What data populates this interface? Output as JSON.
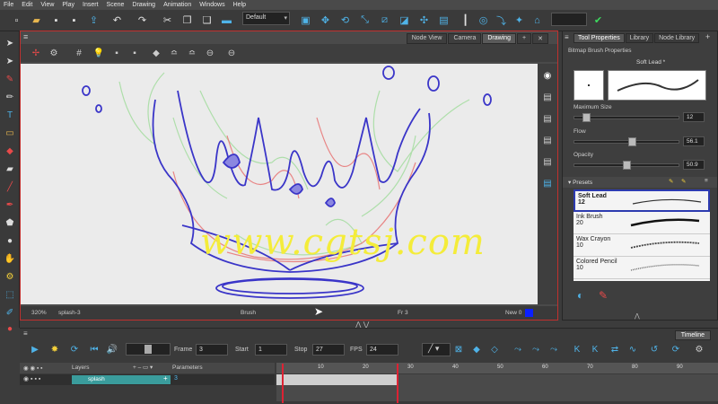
{
  "menubar": {
    "items": [
      "File",
      "Edit",
      "View",
      "Play",
      "Insert",
      "Scene",
      "Drawing",
      "Animation",
      "Windows",
      "Help"
    ]
  },
  "toolbar": {
    "workspace_preset": "Default"
  },
  "view": {
    "tabs": [
      "Node View",
      "Camera",
      "Drawing"
    ],
    "active_tab": "Drawing",
    "status": {
      "zoom": "320%",
      "layer": "splash-3",
      "tool": "Brush",
      "frame": "Fr 3",
      "new_label": "New 0"
    },
    "watermark": "www.cgtsj.com"
  },
  "right_panel": {
    "tabs": [
      "Tool Properties",
      "Library",
      "Node Library"
    ],
    "active_tab": "Tool Properties",
    "section_title": "Bitmap Brush Properties",
    "brush_name": "Soft Lead *",
    "max_size": {
      "label": "Maximum Size",
      "value": "12",
      "level": 0.08
    },
    "flow": {
      "label": "Flow",
      "value": "56.1",
      "level": 0.561
    },
    "opacity": {
      "label": "Opacity",
      "value": "50.9",
      "level": 0.509
    },
    "presets_label": "Presets",
    "presets": [
      {
        "name": "Soft Lead",
        "size": "12"
      },
      {
        "name": "Ink Brush",
        "size": "20"
      },
      {
        "name": "Wax Crayon",
        "size": "10"
      },
      {
        "name": "Colored Pencil",
        "size": "10"
      }
    ]
  },
  "timeline": {
    "tab": "Timeline",
    "frame_label": "Frame",
    "frame_value": "3",
    "start_label": "Start",
    "start_value": "1",
    "stop_label": "Stop",
    "stop_value": "27",
    "fps_label": "FPS",
    "fps_value": "24",
    "layers_label": "Layers",
    "params_label": "Parameters",
    "layer_name": "splash",
    "layer_param": "3",
    "ruler_marks": [
      "10",
      "20",
      "30",
      "40",
      "50",
      "60",
      "70",
      "80",
      "90"
    ]
  },
  "colors": {
    "accent": "#4fb3e8",
    "selection": "#2d3bb0",
    "current_color": "#0b20ff",
    "layer_highlight": "#3a9c9c"
  }
}
